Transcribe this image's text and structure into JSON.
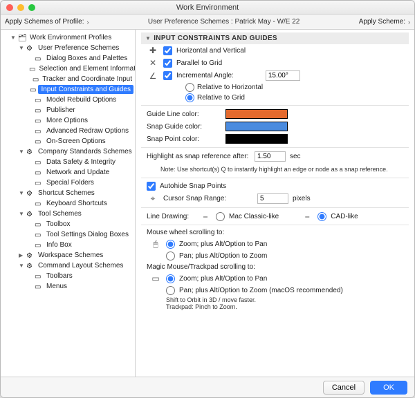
{
  "title": "Work Environment",
  "scheme_bar": {
    "apply_profile": "Apply Schemes of Profile:",
    "mid": "User Preference Schemes : Patrick May - W/E 22",
    "apply_scheme": "Apply Scheme:"
  },
  "tree": {
    "root": "Work Environment Profiles",
    "ups": "User Preference Schemes",
    "ups_items": {
      "0": "Dialog Boxes and Palettes",
      "1": "Selection and Element Information",
      "2": "Tracker and Coordinate Input",
      "3": "Input Constraints and Guides",
      "4": "Model Rebuild Options",
      "5": "Publisher",
      "6": "More Options",
      "7": "Advanced Redraw Options",
      "8": "On-Screen Options"
    },
    "css": "Company Standards Schemes",
    "css_items": {
      "0": "Data Safety & Integrity",
      "1": "Network and Update",
      "2": "Special Folders"
    },
    "ss": "Shortcut Schemes",
    "ss_items": {
      "0": "Keyboard Shortcuts"
    },
    "ts": "Tool Schemes",
    "ts_items": {
      "0": "Toolbox",
      "1": "Tool Settings Dialog Boxes",
      "2": "Info Box"
    },
    "ws": "Workspace Schemes",
    "cls": "Command Layout Schemes",
    "cls_items": {
      "0": "Toolbars",
      "1": "Menus"
    }
  },
  "section": {
    "title": "INPUT CONSTRAINTS AND GUIDES",
    "hv": "Horizontal and Vertical",
    "pg": "Parallel to Grid",
    "ia": "Incremental Angle:",
    "ia_value": "15.00°",
    "rel_h": "Relative to Horizontal",
    "rel_g": "Relative to Grid",
    "guide_line": "Guide Line color:",
    "snap_guide": "Snap Guide color:",
    "snap_point": "Snap Point color:",
    "hl_label": "Highlight as snap reference after:",
    "hl_value": "1.50",
    "hl_unit": "sec",
    "note": "Note: Use shortcut(s) Q to instantly highlight an edge or node as a snap reference.",
    "autohide": "Autohide Snap Points",
    "csr": "Cursor Snap Range:",
    "csr_value": "5",
    "csr_unit": "pixels",
    "ld": "Line Drawing:",
    "ld_mac": "Mac Classic-like",
    "ld_cad": "CAD-like",
    "mw": "Mouse wheel scrolling to:",
    "mw_zoom": "Zoom; plus Alt/Option to Pan",
    "mw_pan": "Pan; plus Alt/Option to Zoom",
    "mm": "Magic Mouse/Trackpad scrolling to:",
    "mm_zoom": "Zoom; plus Alt/Option to Pan",
    "mm_pan": "Pan; plus Alt/Option to Zoom (macOS recommended)",
    "mm_note1": "Shift to Orbit in 3D / move faster.",
    "mm_note2": "Trackpad: Pinch to Zoom."
  },
  "colors": {
    "guide": "#e46a2e",
    "snap_guide": "#4a8bdf",
    "snap_point": "#000000"
  },
  "buttons": {
    "cancel": "Cancel",
    "ok": "OK"
  }
}
